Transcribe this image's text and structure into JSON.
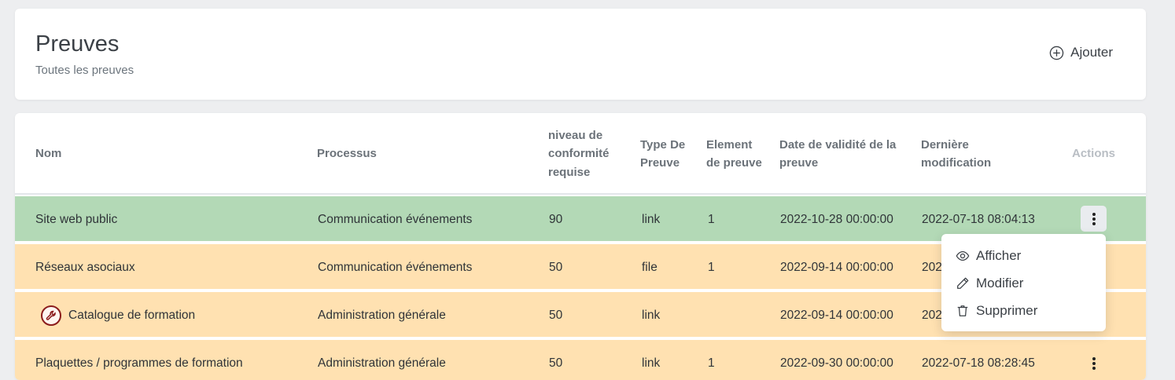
{
  "header": {
    "title": "Preuves",
    "subtitle": "Toutes les preuves",
    "add_label": "Ajouter"
  },
  "table": {
    "columns": [
      "Nom",
      "Processus",
      "niveau de conformité requise",
      "Type De Preuve",
      "Element de preuve",
      "Date de validité de la preuve",
      "Dernière modification",
      "Actions"
    ],
    "rows": [
      {
        "nom": "Site web public",
        "processus": "Communication événements",
        "niveau": "90",
        "type": "link",
        "element": "1",
        "validite": "2022-10-28 00:00:00",
        "modification": "2022-07-18 08:04:13",
        "status": "green"
      },
      {
        "nom": "Réseaux asociaux",
        "processus": "Communication événements",
        "niveau": "50",
        "type": "file",
        "element": "1",
        "validite": "2022-09-14 00:00:00",
        "modification": "202",
        "status": "orange"
      },
      {
        "nom": "Catalogue de formation",
        "processus": "Administration générale",
        "niveau": "50",
        "type": "link",
        "element": "",
        "validite": "2022-09-14 00:00:00",
        "modification": "202",
        "status": "orange",
        "icon": "wrench-warning-icon"
      },
      {
        "nom": "Plaquettes / programmes de formation",
        "processus": "Administration générale",
        "niveau": "50",
        "type": "link",
        "element": "1",
        "validite": "2022-09-30 00:00:00",
        "modification": "2022-07-18 08:28:45",
        "status": "orange"
      }
    ]
  },
  "menu": {
    "items": [
      {
        "label": "Afficher",
        "icon": "eye-icon"
      },
      {
        "label": "Modifier",
        "icon": "pencil-icon"
      },
      {
        "label": "Supprimer",
        "icon": "trash-icon"
      }
    ]
  },
  "colors": {
    "row_green": "#b3d9b6",
    "row_orange": "#ffe1b1",
    "warning_icon": "#8b1c1c"
  }
}
